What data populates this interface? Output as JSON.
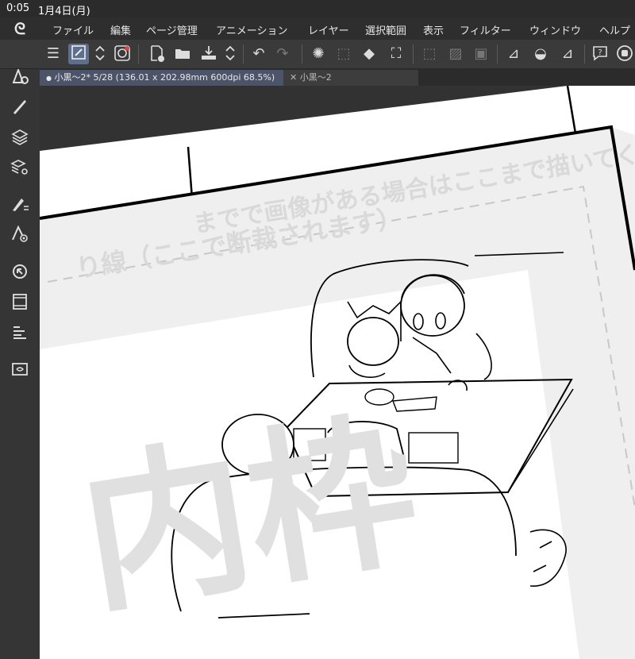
{
  "status": {
    "time": "0:05",
    "date": "1月4日(月)"
  },
  "menu": {
    "items": [
      "ファイル",
      "編集",
      "ページ管理",
      "アニメーション",
      "レイヤー",
      "選択範囲",
      "表示",
      "フィルター",
      "ウィンドウ",
      "ヘルプ"
    ]
  },
  "tabs": {
    "active": "小黒〜2* 5/28 (136.01 x 202.98mm 600dpi 68.5%)",
    "inactive": "小黒〜2",
    "active_bullet": "●",
    "close_glyph": "✕"
  },
  "canvas": {
    "guide_text_1": "までで画像がある場合はここまで描いてください",
    "guide_text_2": "り線（ここで断裁されます）",
    "inner_frame_label": "内枠"
  },
  "colors": {
    "app_bg": "#2b2b2b",
    "toolbar_bg": "#3a3a3a",
    "active_tool": "#5d6f8c",
    "active_tab": "#4b5468",
    "paper": "#ffffff",
    "outer_area": "#efefef",
    "watermark": "#e0e0e0"
  },
  "icons": {
    "toolbar": [
      "menu-icon",
      "pen-tool-icon",
      "stepper-icon",
      "spiral-icon",
      "new-page-icon",
      "open-folder-icon",
      "save-icon",
      "stepper-icon",
      "undo-icon",
      "redo-icon",
      "loading-icon",
      "selection-icon",
      "fill-icon",
      "transform-icon",
      "deselect-icon",
      "clear-icon",
      "frame-icon",
      "ruler-icon",
      "bucket-icon",
      "text-icon",
      "help-icon",
      "record-icon"
    ],
    "sidebar": [
      "tool-settings-icon",
      "brush-icon",
      "layers-icon",
      "layer-property-icon",
      "sub-tool-icon",
      "color-settings-icon",
      "navigator-icon",
      "timeline-icon",
      "material-icon",
      "speech-balloon-icon"
    ]
  }
}
